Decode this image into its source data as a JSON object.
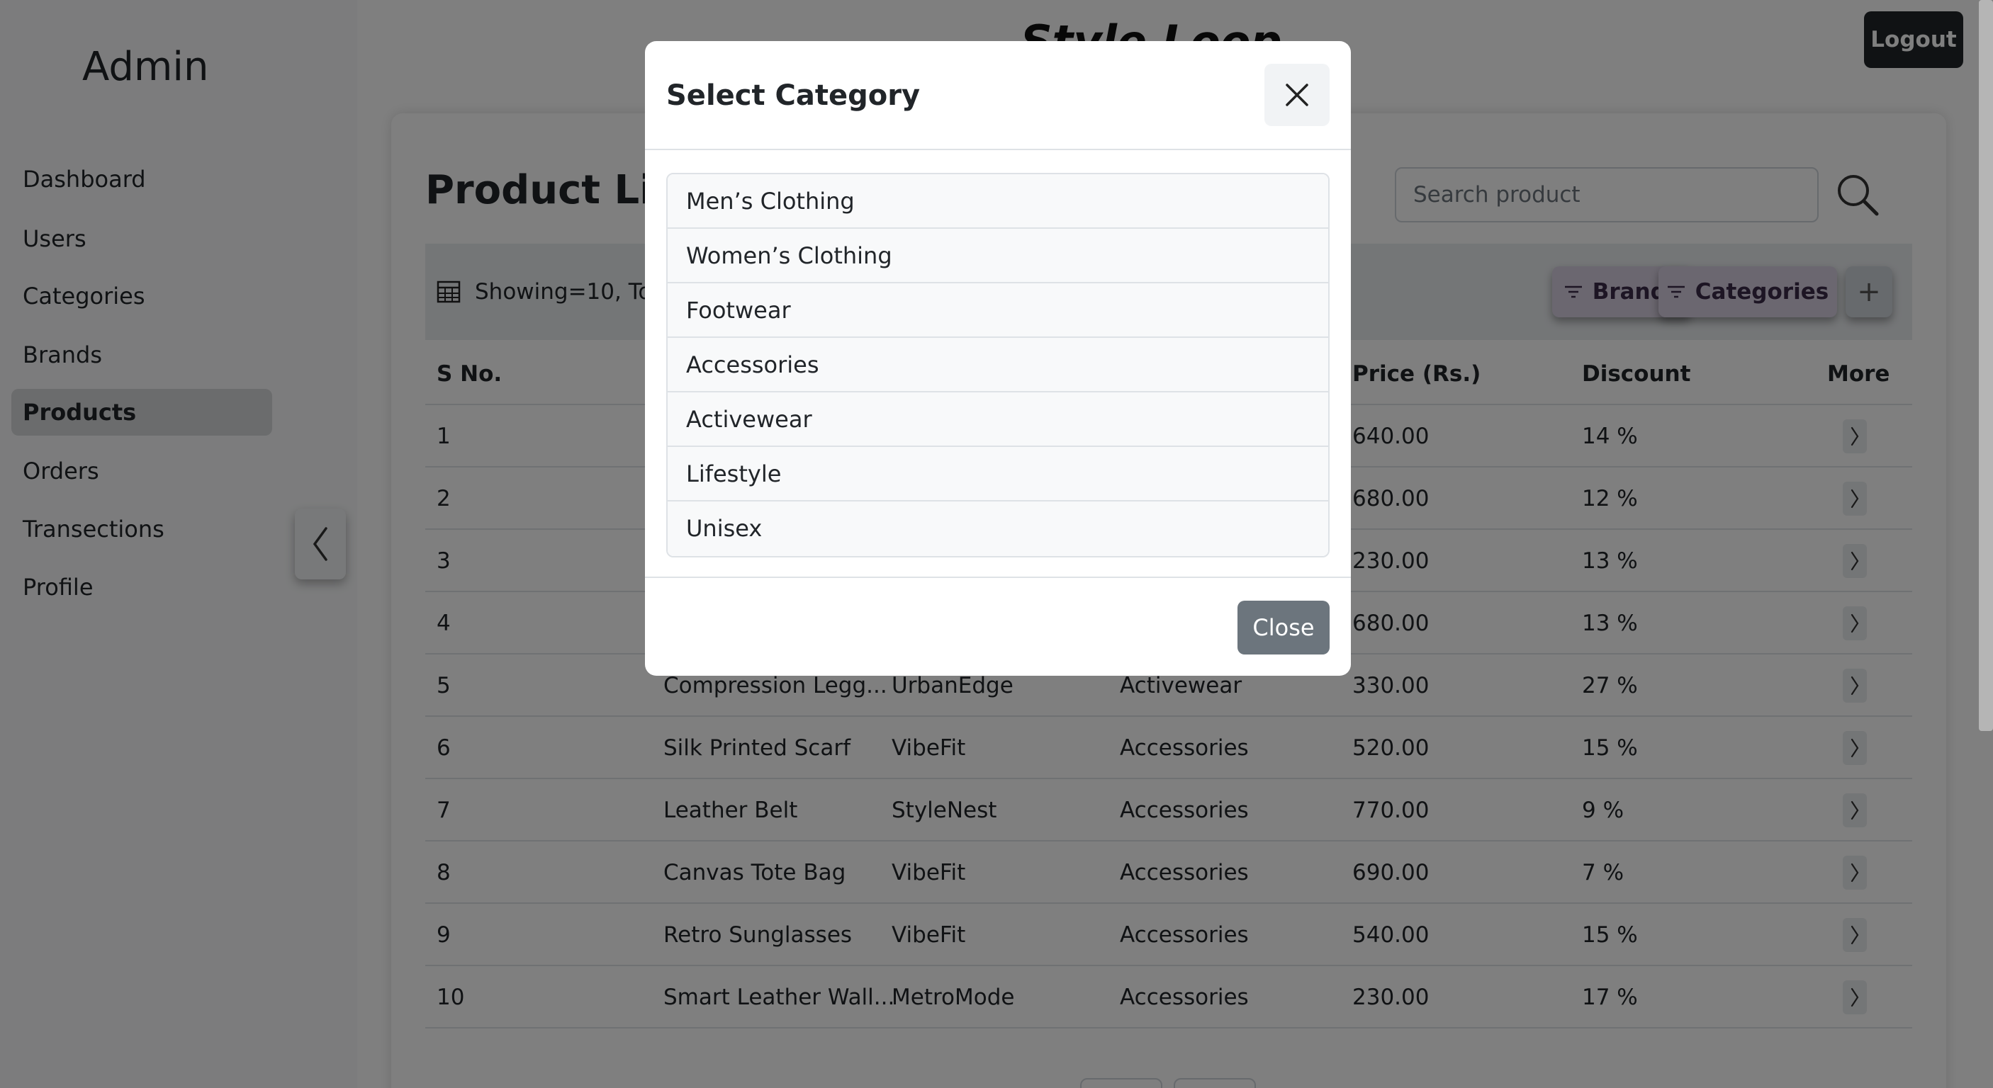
{
  "sidebar": {
    "title": "Admin",
    "items": [
      {
        "label": "Dashboard"
      },
      {
        "label": "Users"
      },
      {
        "label": "Categories"
      },
      {
        "label": "Brands"
      },
      {
        "label": "Products",
        "active": true
      },
      {
        "label": "Orders"
      },
      {
        "label": "Transections"
      },
      {
        "label": "Profile"
      }
    ],
    "collapse_icon": "chevron-left-icon"
  },
  "header": {
    "brand": "Style Loop",
    "logout_label": "Logout"
  },
  "main": {
    "heading": "Product List",
    "search": {
      "placeholder": "Search product",
      "value": ""
    },
    "showing_text": "Showing=10, Tot",
    "filters": {
      "brands_label": "Brands",
      "categories_label": "Categories",
      "add_label": "+"
    },
    "table": {
      "headers": [
        "S No.",
        "",
        "",
        "",
        "Price (Rs.)",
        "Discount",
        "More"
      ],
      "rows": [
        {
          "sno": "1",
          "name": "",
          "brand": "",
          "category": "",
          "price": "640.00",
          "discount": "14 %"
        },
        {
          "sno": "2",
          "name": "",
          "brand": "",
          "category": "",
          "price": "680.00",
          "discount": "12 %"
        },
        {
          "sno": "3",
          "name": "",
          "brand": "",
          "category": "",
          "price": "230.00",
          "discount": "13 %"
        },
        {
          "sno": "4",
          "name": "",
          "brand": "",
          "category": "",
          "price": "680.00",
          "discount": "13 %"
        },
        {
          "sno": "5",
          "name": "Compression Legg...",
          "brand": "UrbanEdge",
          "category": "Activewear",
          "price": "330.00",
          "discount": "27 %"
        },
        {
          "sno": "6",
          "name": "Silk Printed Scarf",
          "brand": "VibeFit",
          "category": "Accessories",
          "price": "520.00",
          "discount": "15 %"
        },
        {
          "sno": "7",
          "name": "Leather Belt",
          "brand": "StyleNest",
          "category": "Accessories",
          "price": "770.00",
          "discount": "9 %"
        },
        {
          "sno": "8",
          "name": "Canvas Tote Bag",
          "brand": "VibeFit",
          "category": "Accessories",
          "price": "690.00",
          "discount": "7 %"
        },
        {
          "sno": "9",
          "name": "Retro Sunglasses",
          "brand": "VibeFit",
          "category": "Accessories",
          "price": "540.00",
          "discount": "15 %"
        },
        {
          "sno": "10",
          "name": "Smart Leather Wall...",
          "brand": "MetroMode",
          "category": "Accessories",
          "price": "230.00",
          "discount": "17 %"
        }
      ]
    }
  },
  "modal": {
    "title": "Select Category",
    "categories": [
      "Men’s Clothing",
      "Women’s Clothing",
      "Footwear",
      "Accessories",
      "Activewear",
      "Lifestyle",
      "Unisex"
    ],
    "close_label": "Close"
  },
  "colors": {
    "sidebar_bg": "#f8f9fa",
    "active_nav_bg": "#d6d8db",
    "filter_btn_bg": "#d7cfe0",
    "dark_btn": "#212529",
    "secondary_btn": "#6c757d",
    "backdrop": "rgba(0,0,0,0.5)"
  }
}
